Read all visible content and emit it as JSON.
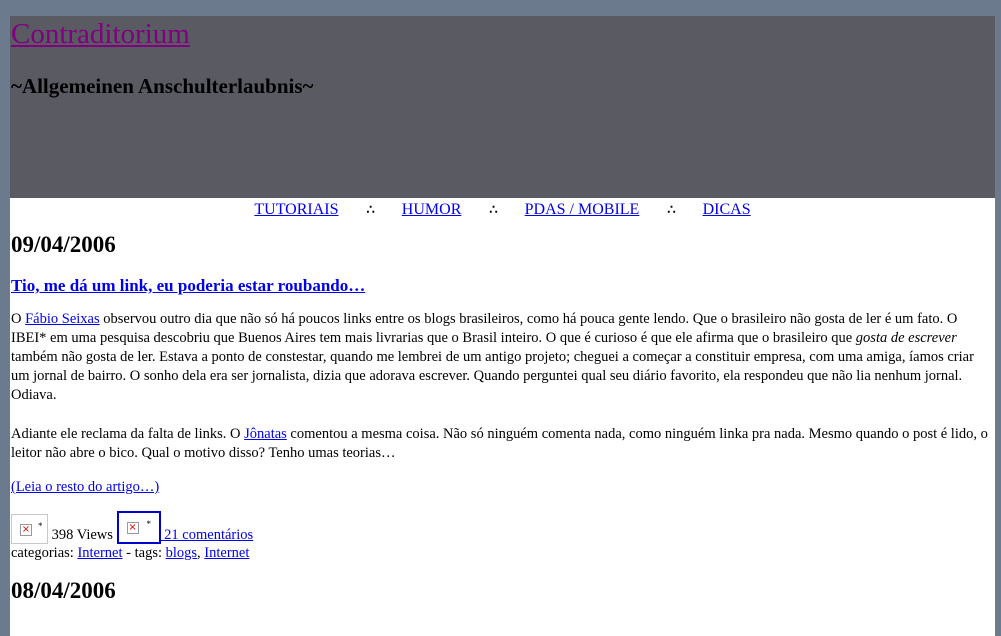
{
  "site": {
    "title": "Contraditorium",
    "tagline": "~Allgemeinen Anschulterlaubnis~"
  },
  "nav": {
    "items": [
      "TUTORIAIS",
      "HUMOR",
      "PDAS / MOBILE",
      "DICAS"
    ],
    "separator": "∴"
  },
  "post": {
    "date": "09/04/2006",
    "title": "Tio, me dá um link, eu poderia estar roubando…",
    "p1_a": "O ",
    "p1_link": "Fábio Seixas",
    "p1_b": " observou outro dia que não só há poucos links entre os blogs brasileiros, como há pouca gente lendo. Que o brasileiro não gosta de ler é um fato. O IBEI* em uma pesquisa descobriu que Buenos Aires tem mais livrarias que o Brasil inteiro. O que é curioso é que ele afirma que o brasileiro que ",
    "p1_em": "gosta de escrever",
    "p1_c": " também não gosta de ler. Estava a ponto de constestar, quando me lembrei de um antigo projeto; cheguei a começar a constituir empresa, com uma amiga, íamos criar um jornal de bairro. O sonho dela era ser jornalista, dizia que adorava escrever. Quando perguntei qual seu diário favorito, ela respondeu que não lia nenhum jornal. Odiava.",
    "p2_a": "Adiante ele reclama da falta de links. O ",
    "p2_link": "Jônatas",
    "p2_b": " comentou a mesma coisa. Não só ninguém comenta nada, como ninguém linka pra nada. Mesmo quando o post é lido, o leitor não abre o bico. Qual o motivo disso? Tenho umas teorias…",
    "read_more": "(Leia o resto do artigo…)",
    "views": "398 Views",
    "comments": " 21 comentários",
    "categories_label": "categorias: ",
    "category": "Internet",
    "tags_label": " - tags: ",
    "tag1": "blogs",
    "tag_sep": ", ",
    "tag2": "Internet"
  },
  "next_date": "08/04/2006",
  "colors": {
    "page_bg": "#6b7a8c",
    "header_bg": "#5a5a62",
    "title": "#800080",
    "link": "#0000ee"
  }
}
